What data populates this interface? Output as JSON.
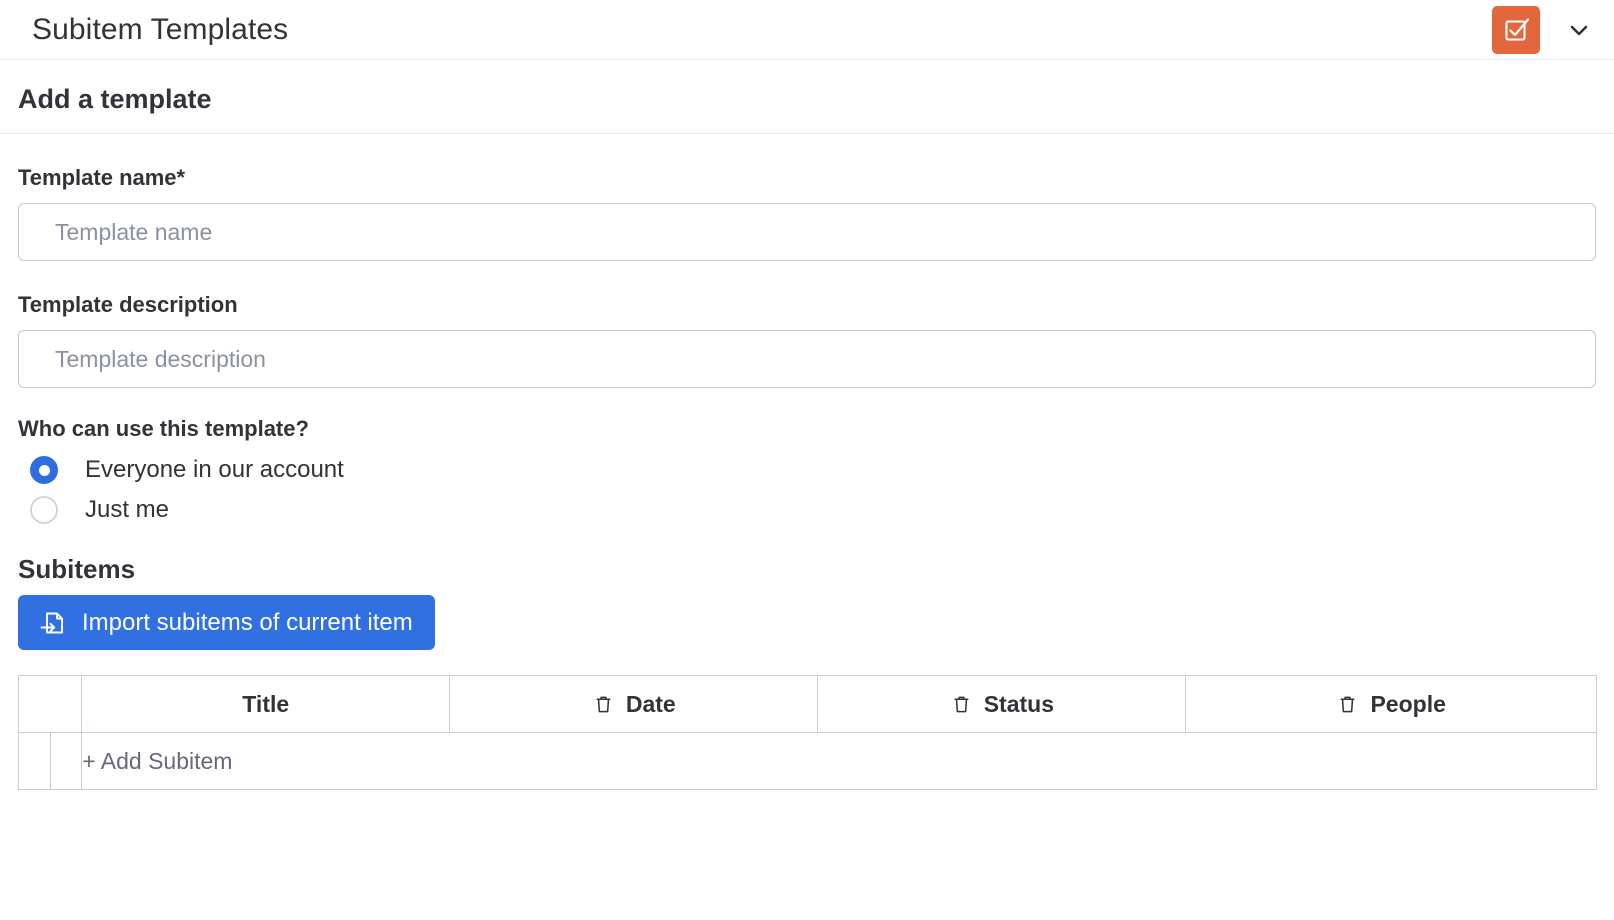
{
  "topbar": {
    "title": "Subitem Templates",
    "board_icon": "checkbox-board-icon",
    "board_icon_color": "#e2673d",
    "chevron_icon": "chevron-down-icon"
  },
  "section": {
    "title": "Add a template"
  },
  "form": {
    "template_name": {
      "label": "Template name*",
      "value": "",
      "placeholder": "Template name"
    },
    "template_description": {
      "label": "Template description",
      "value": "",
      "placeholder": "Template description"
    },
    "permission": {
      "label": "Who can use this template?",
      "options": [
        {
          "label": "Everyone in our account",
          "selected": true
        },
        {
          "label": "Just me",
          "selected": false
        }
      ]
    }
  },
  "subitems": {
    "heading": "Subitems",
    "import_button": {
      "label": "Import subitems of current item",
      "icon": "import-file-icon",
      "color": "#3070e0"
    },
    "table": {
      "columns": [
        {
          "label": "",
          "icon": null
        },
        {
          "label": "Title",
          "icon": null
        },
        {
          "label": "Date",
          "icon": "trash-icon"
        },
        {
          "label": "Status",
          "icon": "trash-icon"
        },
        {
          "label": "People",
          "icon": "trash-icon"
        }
      ],
      "rows": [
        {
          "add_label": "+ Add Subitem"
        }
      ]
    }
  },
  "colors": {
    "accent_blue": "#3070e0",
    "radio_blue": "#2f6ee0",
    "brand_orange": "#e2673d",
    "border": "#c8cbd9",
    "input_border": "#c5c7d0",
    "placeholder": "#8d90a2",
    "text": "#323338",
    "muted_text": "#676879"
  }
}
